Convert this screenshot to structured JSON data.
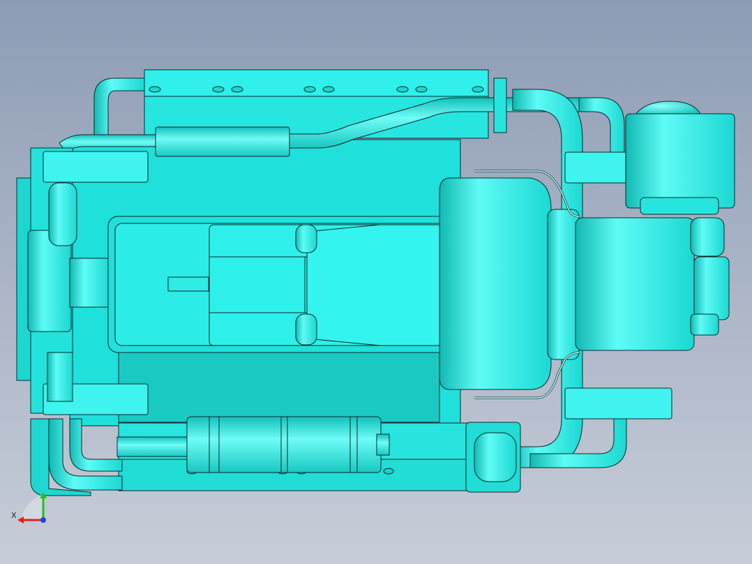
{
  "viewport": {
    "background_top": "#8d9cb5",
    "background_bottom": "#c7cdd8",
    "part_color": "#1fe8e2",
    "part_highlight": "#5ffbf6",
    "part_shadow": "#12b8b2",
    "edge_color": "#0a2a2a",
    "model": "engine-assembly-top-view"
  },
  "triad": {
    "x_label": "X",
    "x_color": "#e02020",
    "y_color": "#20c020",
    "z_color": "#2040e0"
  }
}
